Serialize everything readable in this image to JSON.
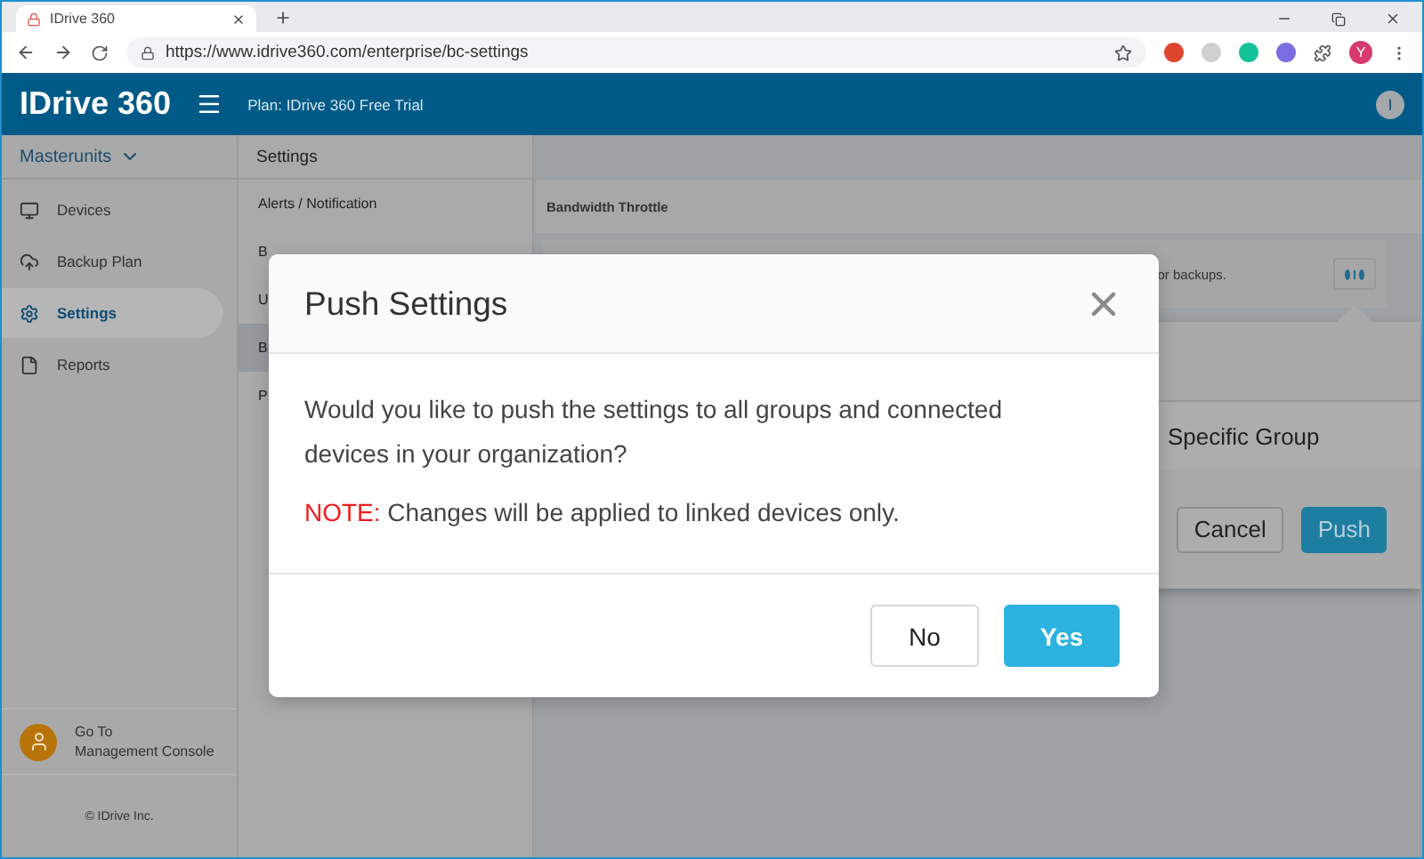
{
  "browser": {
    "tab": {
      "title": "IDrive 360",
      "selected": true
    },
    "url": "https://www.idrive360.com/enterprise/bc-settings",
    "profile": "Y"
  },
  "header": {
    "logo": "IDrive",
    "logo_suffix": "360",
    "plan": "Plan: IDrive 360 Free Trial",
    "user": "I"
  },
  "sidebar": {
    "account": "Masterunits",
    "items": [
      {
        "label": "Devices",
        "selected": false
      },
      {
        "label": "Backup Plan",
        "selected": false
      },
      {
        "label": "Settings",
        "selected": true
      },
      {
        "label": "Reports",
        "selected": false
      }
    ],
    "console": [
      "Go To",
      "Management Console"
    ],
    "copyright": "© IDrive Inc."
  },
  "settings": {
    "title": "Settings",
    "items": [
      {
        "label": "Alerts / Notification",
        "selected": false
      },
      {
        "label": "B",
        "selected": false
      },
      {
        "label": "U",
        "selected": false
      },
      {
        "label": "B",
        "selected": true
      },
      {
        "label": "P",
        "selected": false
      }
    ]
  },
  "content": {
    "section_title": "Bandwidth Throttle",
    "card_text": "or backups.",
    "popover": {
      "option": "Specific Group",
      "buttons": [
        {
          "label": "Cancel",
          "kind": "secondary"
        },
        {
          "label": "Push",
          "kind": "primary"
        }
      ]
    }
  },
  "modal": {
    "title": "Push Settings",
    "message": "Would you like to push the settings to all groups and connected devices in your organization?",
    "note_label": "NOTE:",
    "note": "Changes will be applied to linked devices only.",
    "buttons": [
      {
        "label": "No",
        "kind": "secondary"
      },
      {
        "label": "Yes",
        "kind": "primary"
      }
    ]
  }
}
